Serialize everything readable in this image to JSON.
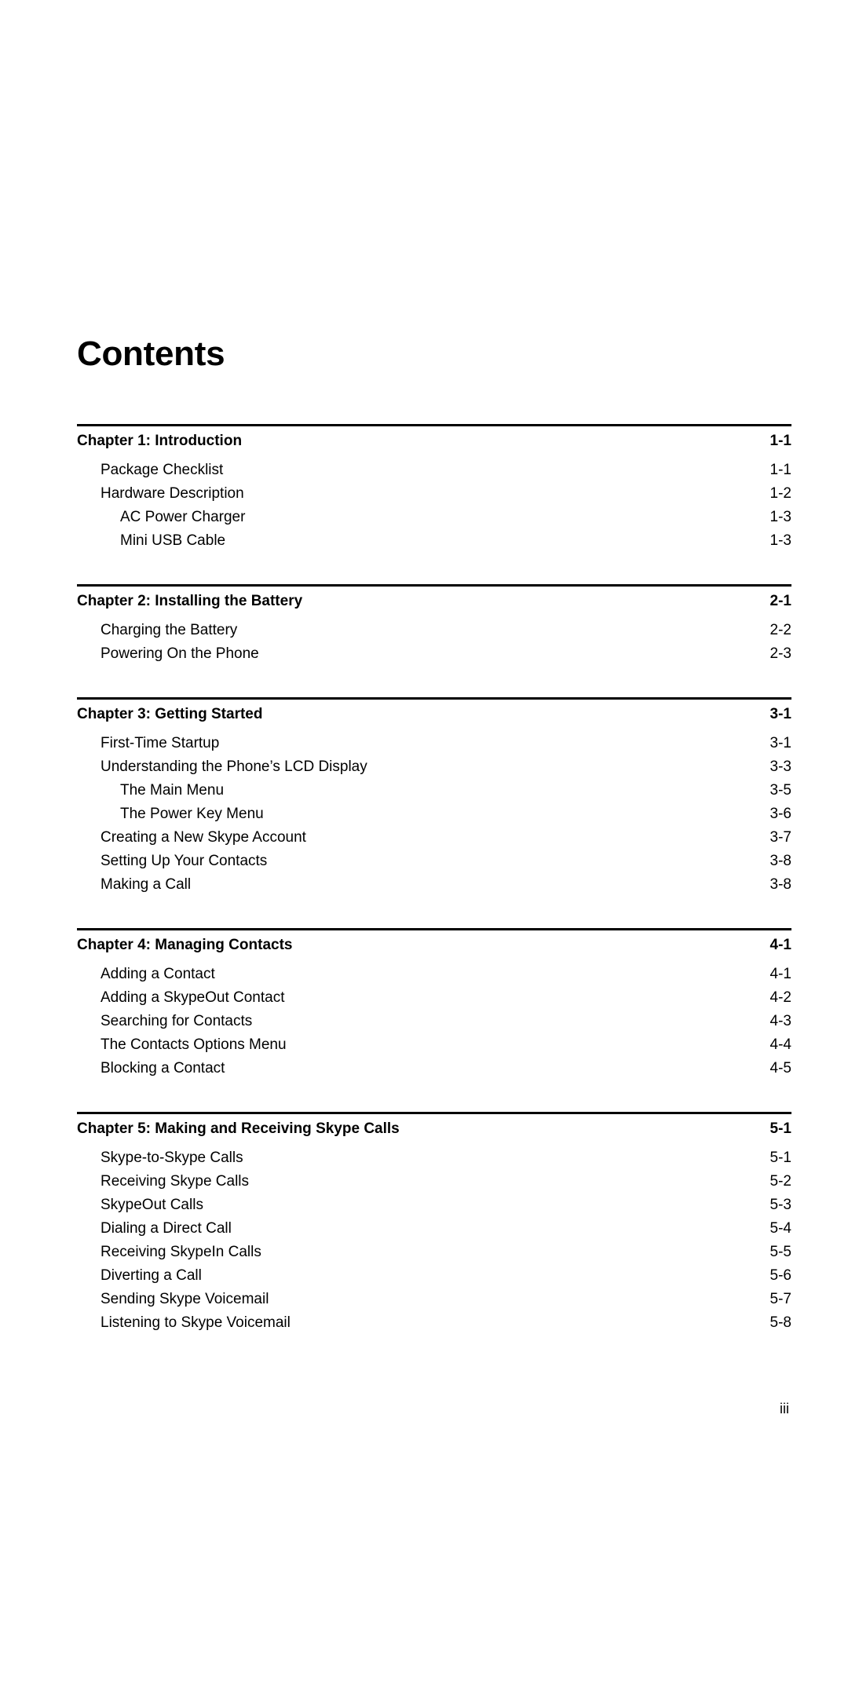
{
  "document": {
    "title": "Contents",
    "folio": "iii"
  },
  "toc": {
    "chapters": [
      {
        "title": "Chapter 1: Introduction",
        "page": "1-1",
        "entries": [
          {
            "label": "Package Checklist",
            "page": "1-1",
            "level": 1
          },
          {
            "label": "Hardware Description",
            "page": "1-2",
            "level": 1
          },
          {
            "label": "AC Power Charger",
            "page": "1-3",
            "level": 2
          },
          {
            "label": "Mini USB Cable",
            "page": "1-3",
            "level": 2
          }
        ]
      },
      {
        "title": "Chapter 2: Installing the Battery",
        "page": "2-1",
        "entries": [
          {
            "label": "Charging the Battery",
            "page": "2-2",
            "level": 1
          },
          {
            "label": "Powering On the Phone",
            "page": "2-3",
            "level": 1
          }
        ]
      },
      {
        "title": "Chapter 3: Getting Started",
        "page": "3-1",
        "entries": [
          {
            "label": "First-Time Startup",
            "page": "3-1",
            "level": 1
          },
          {
            "label": "Understanding the Phone’s LCD Display",
            "page": "3-3",
            "level": 1
          },
          {
            "label": "The Main Menu",
            "page": "3-5",
            "level": 2
          },
          {
            "label": "The Power Key Menu",
            "page": "3-6",
            "level": 2
          },
          {
            "label": "Creating a New Skype Account",
            "page": "3-7",
            "level": 1
          },
          {
            "label": "Setting Up Your Contacts",
            "page": "3-8",
            "level": 1
          },
          {
            "label": "Making a Call",
            "page": "3-8",
            "level": 1
          }
        ]
      },
      {
        "title": "Chapter 4: Managing Contacts",
        "page": "4-1",
        "entries": [
          {
            "label": "Adding a Contact",
            "page": "4-1",
            "level": 1
          },
          {
            "label": "Adding a SkypeOut Contact",
            "page": "4-2",
            "level": 1
          },
          {
            "label": "Searching for Contacts",
            "page": "4-3",
            "level": 1
          },
          {
            "label": "The Contacts Options Menu",
            "page": "4-4",
            "level": 1
          },
          {
            "label": "Blocking a Contact",
            "page": "4-5",
            "level": 1
          }
        ]
      },
      {
        "title": "Chapter 5: Making and Receiving Skype Calls",
        "page": "5-1",
        "entries": [
          {
            "label": "Skype-to-Skype Calls",
            "page": "5-1",
            "level": 1
          },
          {
            "label": "Receiving Skype Calls",
            "page": "5-2",
            "level": 1
          },
          {
            "label": "SkypeOut Calls",
            "page": "5-3",
            "level": 1
          },
          {
            "label": "Dialing a Direct Call",
            "page": "5-4",
            "level": 1
          },
          {
            "label": "Receiving SkypeIn Calls",
            "page": "5-5",
            "level": 1
          },
          {
            "label": "Diverting a Call",
            "page": "5-6",
            "level": 1
          },
          {
            "label": "Sending Skype Voicemail",
            "page": "5-7",
            "level": 1
          },
          {
            "label": "Listening to Skype Voicemail",
            "page": "5-8",
            "level": 1
          }
        ]
      }
    ]
  }
}
